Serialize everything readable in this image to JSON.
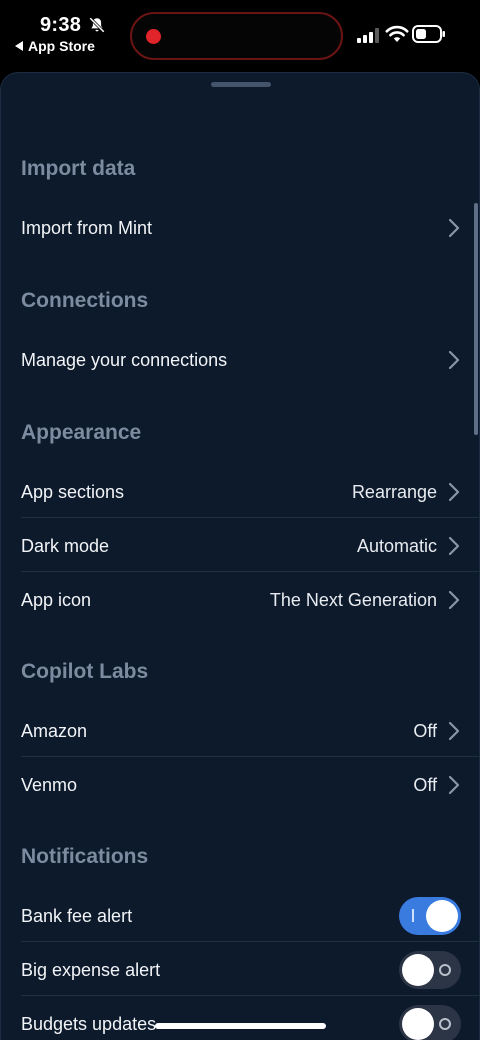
{
  "status_bar": {
    "time": "9:38",
    "back_label": "App Store",
    "icons": [
      "bell-slash-icon",
      "signal-icon",
      "wifi-icon",
      "battery-icon"
    ],
    "recording_color": "#e0242a"
  },
  "sections": {
    "import": {
      "title": "Import data",
      "rows": [
        {
          "label": "Import from Mint",
          "value": ""
        }
      ]
    },
    "connections": {
      "title": "Connections",
      "rows": [
        {
          "label": "Manage your connections",
          "value": ""
        }
      ]
    },
    "appearance": {
      "title": "Appearance",
      "rows": [
        {
          "label": "App sections",
          "value": "Rearrange"
        },
        {
          "label": "Dark mode",
          "value": "Automatic"
        },
        {
          "label": "App icon",
          "value": "The Next Generation"
        }
      ]
    },
    "labs": {
      "title": "Copilot Labs",
      "rows": [
        {
          "label": "Amazon",
          "value": "Off"
        },
        {
          "label": "Venmo",
          "value": "Off"
        }
      ]
    },
    "notifications": {
      "title": "Notifications",
      "rows": [
        {
          "label": "Bank fee alert",
          "enabled": true
        },
        {
          "label": "Big expense alert",
          "enabled": false
        },
        {
          "label": "Budgets updates",
          "enabled": false
        }
      ]
    }
  },
  "colors": {
    "sheet_background": "#0c1a2c",
    "section_title": "#7d8ba0",
    "toggle_on": "#3a7be0",
    "toggle_off": "#2c3545"
  }
}
